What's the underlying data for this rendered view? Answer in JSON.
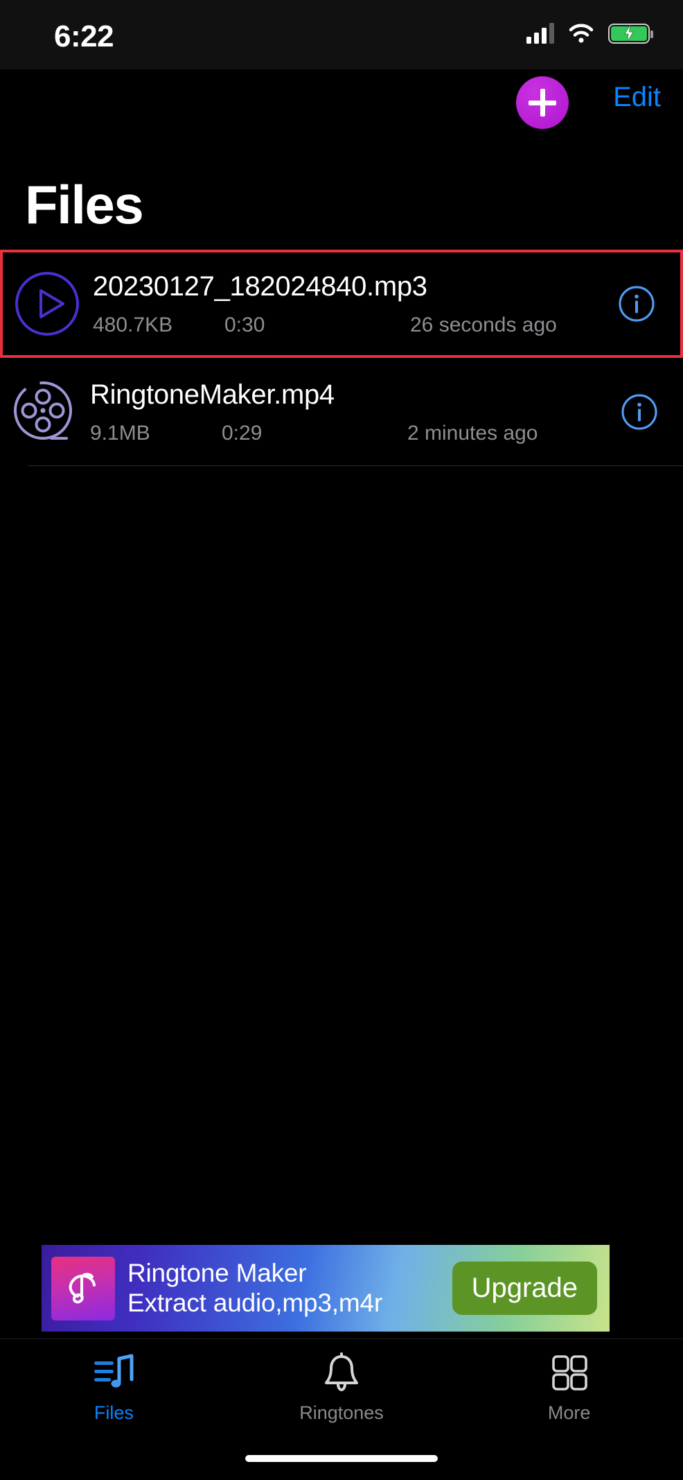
{
  "status_bar": {
    "time": "6:22",
    "cellular_icon": "cellular-bars-icon",
    "wifi_icon": "wifi-icon",
    "battery_icon": "battery-charging-icon",
    "battery_color": "#34c759"
  },
  "nav": {
    "add_label": "+",
    "add_icon": "plus-icon",
    "add_color": "#bb1fd8",
    "edit_label": "Edit",
    "edit_color": "#0a84ff"
  },
  "header": {
    "title": "Files"
  },
  "highlight": {
    "color": "#e8313f",
    "target_row_index": 0
  },
  "files": {
    "columns": [
      "name",
      "size",
      "duration",
      "modified"
    ],
    "rows": [
      {
        "name": "20230127_182024840.mp3",
        "size": "480.7KB",
        "duration": "0:30",
        "modified": "26 seconds ago",
        "icon": "play-circle-icon",
        "icon_color": "#4b2fd0",
        "info_icon": "info-circle-icon",
        "highlighted": true
      },
      {
        "name": "RingtoneMaker.mp4",
        "size": "9.1MB",
        "duration": "0:29",
        "modified": "2 minutes ago",
        "icon": "film-reel-icon",
        "icon_color": "#9d96d6",
        "info_icon": "info-circle-icon",
        "highlighted": false
      }
    ]
  },
  "ad": {
    "logo_icon": "music-note-app-icon",
    "title": "Ringtone Maker",
    "subtitle": "Extract audio,mp3,m4r",
    "cta_label": "Upgrade",
    "cta_color": "#5c9526"
  },
  "tabs": [
    {
      "label": "Files",
      "icon": "music-list-icon",
      "active": true
    },
    {
      "label": "Ringtones",
      "icon": "bell-icon",
      "active": false
    },
    {
      "label": "More",
      "icon": "grid-icon",
      "active": false
    }
  ],
  "accent_color": "#0a84ff"
}
